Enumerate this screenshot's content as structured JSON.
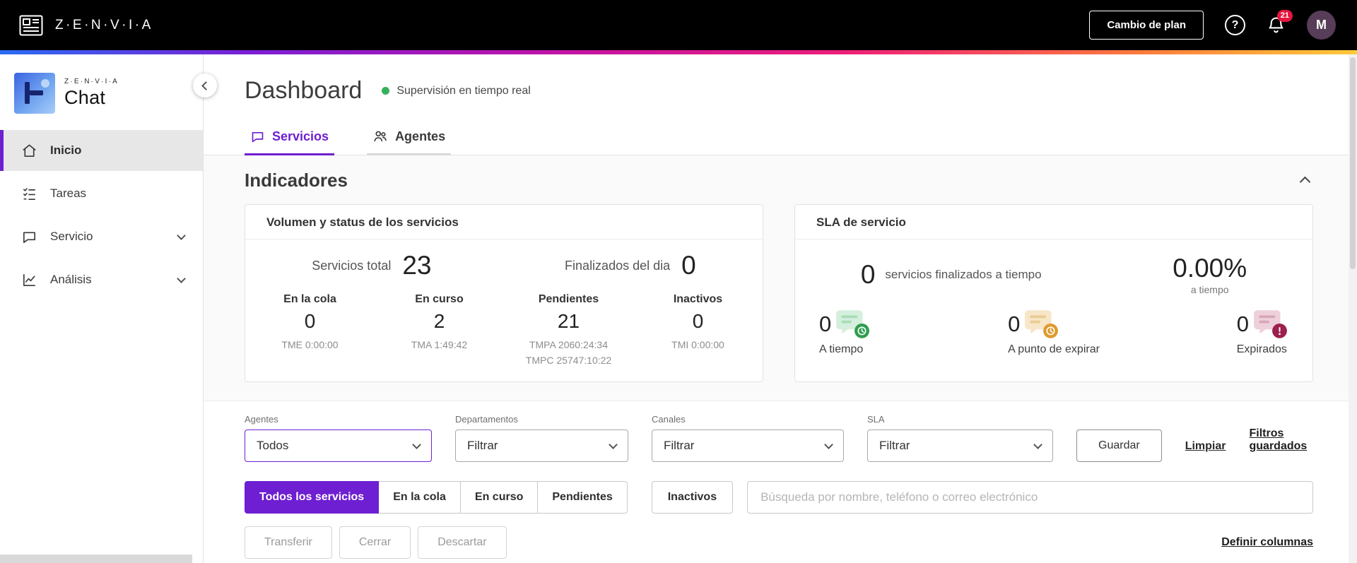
{
  "header": {
    "brand": "Z·E·N·V·I·A",
    "change_plan_button": "Cambio de plan",
    "notification_count": "21",
    "avatar_initial": "M"
  },
  "icons": {
    "help_glyph": "?"
  },
  "sidebar": {
    "logo_brand": "Z·E·N·V·I·A",
    "logo_product": "Chat",
    "items": [
      {
        "label": "Inicio",
        "active": true,
        "expandable": false
      },
      {
        "label": "Tareas",
        "active": false,
        "expandable": false
      },
      {
        "label": "Servicio",
        "active": false,
        "expandable": true
      },
      {
        "label": "Análisis",
        "active": false,
        "expandable": true
      }
    ]
  },
  "page": {
    "title": "Dashboard",
    "status": "Supervisión en tiempo real",
    "tabs": [
      {
        "label": "Servicios",
        "active": true
      },
      {
        "label": "Agentes",
        "active": false
      }
    ]
  },
  "indicators": {
    "section_title": "Indicadores",
    "volume_card": {
      "title": "Volumen y status de los servicios",
      "total_label": "Servicios total",
      "total_value": "23",
      "finished_label": "Finalizados del dia",
      "finished_value": "0",
      "stats": [
        {
          "label": "En la cola",
          "value": "0",
          "sub": [
            "TME 0:00:00"
          ]
        },
        {
          "label": "En curso",
          "value": "2",
          "sub": [
            "TMA 1:49:42"
          ]
        },
        {
          "label": "Pendientes",
          "value": "21",
          "sub": [
            "TMPA 2060:24:34",
            "TMPC 25747:10:22"
          ]
        },
        {
          "label": "Inactivos",
          "value": "0",
          "sub": [
            "TMI 0:00:00"
          ]
        }
      ]
    },
    "sla_card": {
      "title": "SLA de servicio",
      "ontime_value": "0",
      "ontime_label": "servicios finalizados a tiempo",
      "percent_value": "0.00%",
      "percent_label": "a tiempo",
      "stats": [
        {
          "value": "0",
          "label": "A tiempo"
        },
        {
          "value": "0",
          "label": "A punto de expirar"
        },
        {
          "value": "0",
          "label": "Expirados"
        }
      ]
    }
  },
  "filters": {
    "fields": [
      {
        "label": "Agentes",
        "value": "Todos"
      },
      {
        "label": "Departamentos",
        "value": "Filtrar"
      },
      {
        "label": "Canales",
        "value": "Filtrar"
      },
      {
        "label": "SLA",
        "value": "Filtrar"
      }
    ],
    "save_button": "Guardar",
    "clear_link": "Limpiar",
    "saved_filters_link": "Filtros guardados"
  },
  "services": {
    "tabs": [
      "Todos los servicios",
      "En la cola",
      "En curso",
      "Pendientes",
      "Inactivos"
    ],
    "search_placeholder": "Búsqueda por nombre, teléfono o correo electrónico",
    "actions": [
      "Transferir",
      "Cerrar",
      "Descartar"
    ],
    "define_columns_link": "Definir columnas"
  },
  "colors": {
    "accent_purple": "#6E1FD1",
    "status_green": "#2E9E4F",
    "status_orange": "#DE9B2D",
    "status_maroon": "#9C1F4E",
    "notification_red": "#E5173F",
    "gradient": [
      "#2A6DF5",
      "#7A1FD6",
      "#C313A4",
      "#ED1E7A",
      "#FF7A3C",
      "#FFC93A"
    ]
  }
}
